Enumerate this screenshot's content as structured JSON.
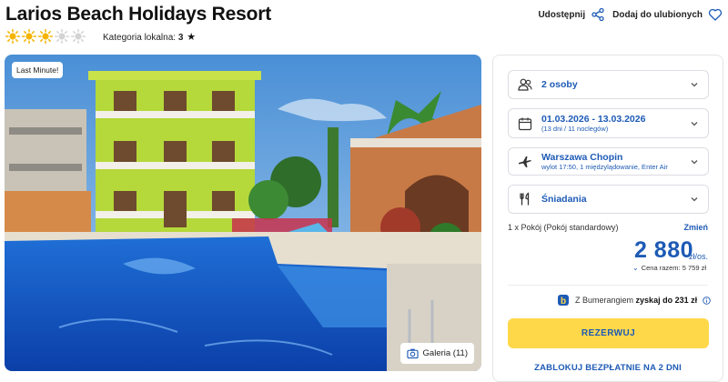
{
  "hotel": {
    "title": "Larios Beach Holidays Resort",
    "rating_suns": 3,
    "rating_max": 5,
    "category_label": "Kategoria lokalna:",
    "category_value": "3",
    "star_symbol": "★"
  },
  "actions": {
    "share_label": "Udostępnij",
    "favorite_label": "Dodaj do ulubionych"
  },
  "gallery": {
    "badge": "Last Minute!",
    "button_label": "Galeria (11)"
  },
  "booking": {
    "persons": "2 osoby",
    "dates": "01.03.2026 - 13.03.2026",
    "dates_sub": "(13 dni / 11 noclegów)",
    "departure": "Warszawa Chopin",
    "departure_sub": "wylot 17:50, 1 międzylądowanie, Enter Air",
    "board": "Śniadania",
    "room": "1 x Pokój  (Pokój standardowy)",
    "change_label": "Zmień",
    "price": "2 880",
    "price_unit": "zł/os.",
    "total_chevron": "⌄",
    "total": "Cena razem: 5 759 zł",
    "bumerang_prefix": "Z Bumerangiem",
    "bumerang_bold": "zyskaj do 231 zł",
    "reserve_label": "REZERWUJ",
    "block_label": "ZABLOKUJ BEZPŁATNIE NA 2 DNI"
  },
  "colors": {
    "accent": "#1d5ab5",
    "button": "#ffd84a",
    "sun_on": "#f5b400",
    "sun_off": "#d3d3d3"
  }
}
